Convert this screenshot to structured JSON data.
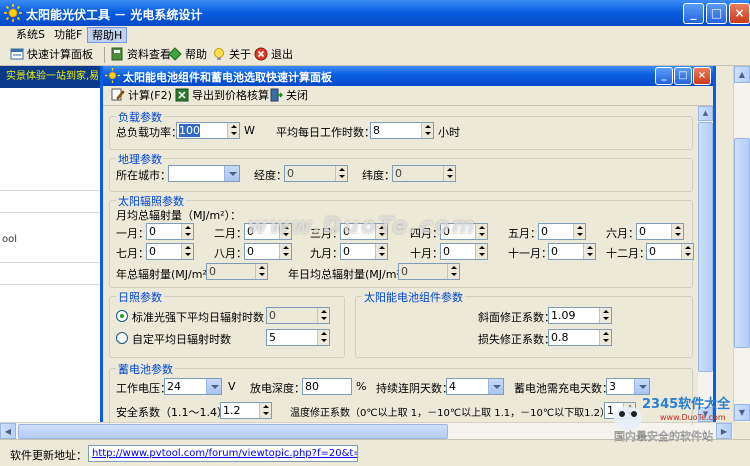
{
  "main_window": {
    "title": "太阳能光伏工具 － 光电系统设计",
    "controls": {
      "minimize": "_",
      "maximize": "□",
      "close": "×"
    }
  },
  "menu": {
    "items": [
      "系统S",
      "功能F",
      "帮助H"
    ],
    "active": "帮助H"
  },
  "toolbar": {
    "quick_calc": "快速计算面板",
    "data_view": "资料查看",
    "help": "帮助",
    "about": "关于",
    "exit": "退出"
  },
  "left_panel": {
    "marquee": "实景体验一站到家,易",
    "partial_text": "ool"
  },
  "child_window": {
    "title": "太阳能电池组件和蓄电池选取快速计算面板",
    "toolbar": {
      "calc": "计算(F2)",
      "export": "导出到价格核算",
      "close": "关闭"
    }
  },
  "load": {
    "legend": "负载参数",
    "power_label": "总负载功率：",
    "power_value": "100",
    "power_unit": "W",
    "hours_label": "平均每日工作时数：",
    "hours_value": "8",
    "hours_unit": "小时"
  },
  "geo": {
    "legend": "地理参数",
    "city_label": "所在城市：",
    "city_value": "",
    "lon_label": "经度：",
    "lon_value": "0",
    "lat_label": "纬度：",
    "lat_value": "0"
  },
  "solar": {
    "legend": "太阳辐照参数",
    "monthly_label": "月均总辐射量（MJ/m²）：",
    "months": [
      {
        "label": "一月：",
        "value": "0"
      },
      {
        "label": "二月：",
        "value": "0"
      },
      {
        "label": "三月：",
        "value": "0"
      },
      {
        "label": "四月：",
        "value": "0"
      },
      {
        "label": "五月：",
        "value": "0"
      },
      {
        "label": "六月：",
        "value": "0"
      },
      {
        "label": "七月：",
        "value": "0"
      },
      {
        "label": "八月：",
        "value": "0"
      },
      {
        "label": "九月：",
        "value": "0"
      },
      {
        "label": "十月：",
        "value": "0"
      },
      {
        "label": "十一月：",
        "value": "0"
      },
      {
        "label": "十二月：",
        "value": "0"
      }
    ],
    "annual_label": "年总辐射量(MJ/m²)：",
    "annual_value": "0",
    "daily_label": "年日均总辐射量(MJ/m²)：",
    "daily_value": "0"
  },
  "sunshine": {
    "legend": "日照参数",
    "option1_label": "标准光强下平均日辐射时数",
    "option1_value": "0",
    "option2_label": "自定平均日辐射时数",
    "option2_value": "5",
    "selected": "option1"
  },
  "panel_params": {
    "legend": "太阳能电池组件参数",
    "tilt_label": "斜面修正系数：",
    "tilt_value": "1.09",
    "loss_label": "损失修正系数：",
    "loss_value": "0.8"
  },
  "battery": {
    "legend": "蓄电池参数",
    "voltage_label": "工作电压：",
    "voltage_value": "24",
    "voltage_unit": "V",
    "dod_label": "放电深度：",
    "dod_value": "80",
    "dod_unit": "%",
    "days_label": "持续连阴天数：",
    "days_value": "4",
    "charge_label": "蓄电池需充电天数：",
    "charge_value": "3",
    "safety_label": "安全系数（1.1～1.4）：",
    "safety_value": "1.2",
    "temp_label": "温度修正系数（0℃以上取 1，－10℃以上取 1.1，－10℃以下取1.2）：",
    "temp_value": "1"
  },
  "status": {
    "label": "软件更新地址：",
    "url": "http://www.pvtool.com/forum/viewtopic.php?f=20&t=248"
  },
  "watermarks": {
    "center": "www.DuoTe.com",
    "corner_brand": "2345软件大全",
    "corner_site": "www.DuoTe.com",
    "corner_slogan": "国内最安全的软件站"
  },
  "colors": {
    "titlebar": "#0a5fe0",
    "legend": "#0046d5",
    "face": "#ece9d8",
    "link": "#0000ee"
  }
}
